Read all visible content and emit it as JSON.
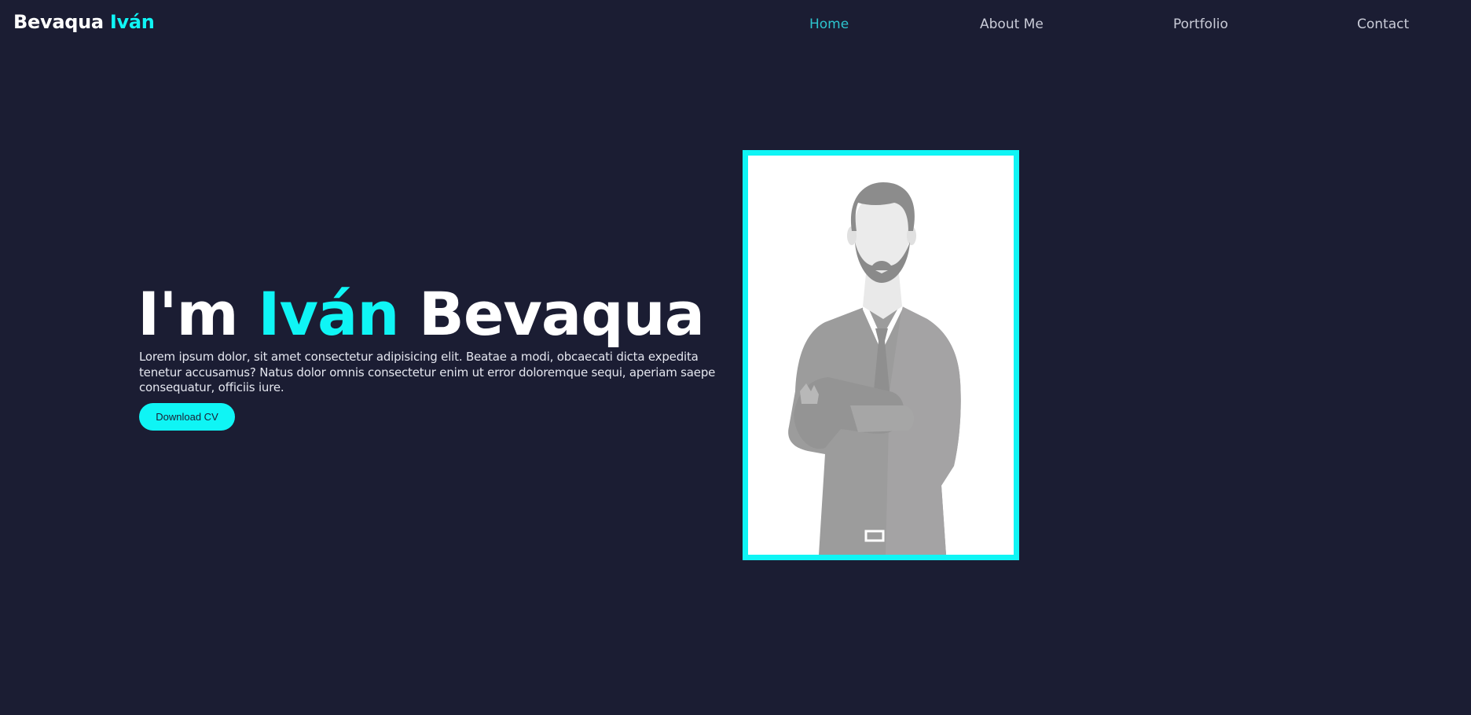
{
  "header": {
    "logo_first": "Bevaqua",
    "logo_second": "Iván"
  },
  "nav": {
    "items": [
      {
        "label": "Home",
        "active": true
      },
      {
        "label": "About Me",
        "active": false
      },
      {
        "label": "Portfolio",
        "active": false
      },
      {
        "label": "Contact",
        "active": false
      }
    ]
  },
  "hero": {
    "title_prefix": "I'm",
    "title_name": "Iván",
    "title_surname": "Bevaqua",
    "description": "Lorem ipsum dolor, sit amet consectetur adipisicing elit. Beatae a modi, obcaecati dicta expedita tenetur accusamus? Natus dolor omnis consectetur enim ut error doloremque sequi, aperiam saepe consequatur, officiis iure.",
    "button_label": "Download CV"
  },
  "colors": {
    "background": "#1b1d33",
    "accent": "#0ff5f5",
    "nav_active": "#2fd3dc",
    "text": "#ffffff"
  },
  "portrait": {
    "icon": "businessman-silhouette"
  }
}
